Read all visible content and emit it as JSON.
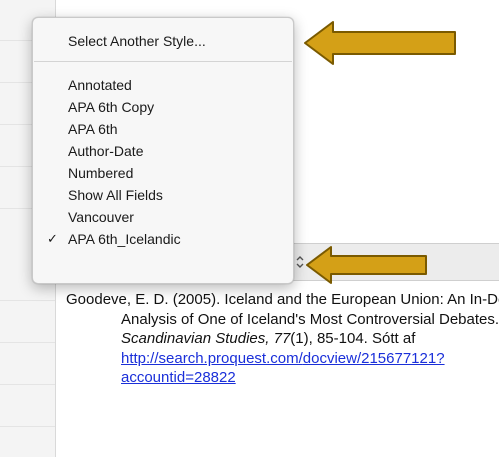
{
  "menu": {
    "top_item": "Select Another Style...",
    "items": [
      {
        "label": "Annotated",
        "checked": false
      },
      {
        "label": "APA 6th Copy",
        "checked": false
      },
      {
        "label": "APA 6th",
        "checked": false
      },
      {
        "label": "Author-Date",
        "checked": false
      },
      {
        "label": "Numbered",
        "checked": false
      },
      {
        "label": "Show All Fields",
        "checked": false
      },
      {
        "label": "Vancouver",
        "checked": false
      },
      {
        "label": "APA 6th_Icelandic",
        "checked": true
      }
    ],
    "check_mark": "✓"
  },
  "reference": {
    "authors_year": "Goodeve, E. D. (2005). ",
    "title": "Iceland and the European Union: An In-Depth Analysis of One of Iceland's Most Controversial Debates. ",
    "journal": "Scandinavian Studies, 77",
    "issue_pages": "(1), 85-104. ",
    "retrieved_prefix": "Sótt af ",
    "url": "http://search.proquest.com/docview/215677121?accountid=28822"
  },
  "icons": {
    "arrows": "arrow-left-icon",
    "selector": "up-down-chevron-icon"
  },
  "colors": {
    "arrow_fill": "#d4a017",
    "arrow_stroke": "#7a5a00",
    "link": "#1a2fd9"
  }
}
